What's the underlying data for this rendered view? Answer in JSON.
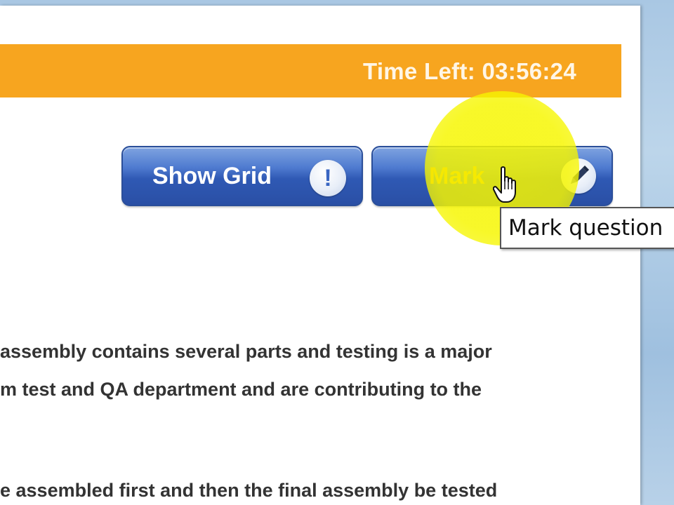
{
  "timer": {
    "text": "Time Left: 03:56:24",
    "bar_color": "#f7a51f"
  },
  "buttons": {
    "show_grid_label": "Show Grid",
    "show_grid_icon": "exclamation-icon",
    "mark_label": "Mark",
    "mark_icon": "pencil-icon"
  },
  "tooltip": {
    "text": "Mark question"
  },
  "question": {
    "lines": [
      "assembly contains several parts and testing is a major",
      "m test and QA department and are contributing to the",
      "e assembled first and then the final assembly be tested"
    ]
  },
  "colors": {
    "button_blue": "#2f59b4",
    "mark_label": "#f0a20e",
    "highlight_yellow": "#f6f600"
  }
}
